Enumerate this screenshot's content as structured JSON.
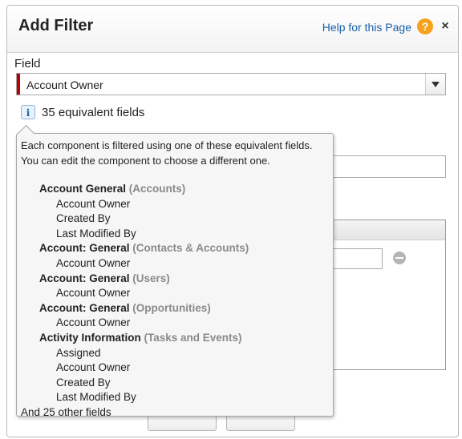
{
  "dialog": {
    "title": "Add Filter",
    "help_link": "Help for this Page",
    "help_icon": "?",
    "close_icon": "×"
  },
  "field": {
    "label": "Field",
    "value": "Account Owner",
    "info_icon": "i",
    "equivalent_count": "35 equivalent fields"
  },
  "tooltip": {
    "description": "Each component is filtered using one of these equivalent fields. You can edit the component to choose a different one.",
    "groups": [
      {
        "name": "Account General",
        "object": "(Accounts)",
        "fields": [
          "Account Owner",
          "Created By",
          "Last Modified By"
        ]
      },
      {
        "name": "Account: General",
        "object": "(Contacts & Accounts)",
        "fields": [
          "Account Owner"
        ]
      },
      {
        "name": "Account: General",
        "object": "(Users)",
        "fields": [
          "Account Owner"
        ]
      },
      {
        "name": "Account: General",
        "object": "(Opportunities)",
        "fields": [
          "Account Owner"
        ]
      },
      {
        "name": "Activity Information",
        "object": "(Tasks and Events)",
        "fields": [
          "Assigned",
          "Account Owner",
          "Created By",
          "Last Modified By"
        ]
      }
    ],
    "footer": "And 25 other fields"
  },
  "colors": {
    "required": "#c00000",
    "link": "#1a5fa8",
    "help_icon": "#f7a21c",
    "muted_object": "#8a8a8a"
  }
}
